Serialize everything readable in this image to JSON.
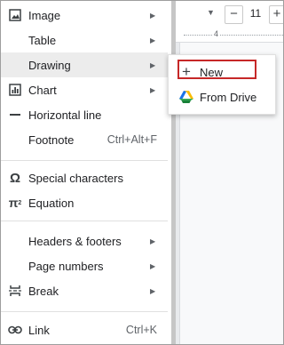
{
  "toolbar": {
    "font_size": "11",
    "decrease_label": "−",
    "increase_label": "+",
    "dropdown_icon": "caret-down-icon"
  },
  "ruler": {
    "marker": "4"
  },
  "menu": {
    "items": [
      {
        "label": "Image",
        "icon": "image-icon",
        "has_submenu": true
      },
      {
        "label": "Table",
        "icon": "",
        "has_submenu": true
      },
      {
        "label": "Drawing",
        "icon": "",
        "has_submenu": true,
        "active": true
      },
      {
        "label": "Chart",
        "icon": "chart-icon",
        "has_submenu": true
      },
      {
        "label": "Horizontal line",
        "icon": "horizontal-line-icon"
      },
      {
        "label": "Footnote",
        "icon": "",
        "shortcut": "Ctrl+Alt+F"
      },
      {
        "label": "Special characters",
        "icon": "omega-icon"
      },
      {
        "label": "Equation",
        "icon": "pi-icon"
      },
      {
        "label": "Headers & footers",
        "icon": "",
        "has_submenu": true
      },
      {
        "label": "Page numbers",
        "icon": "",
        "has_submenu": true
      },
      {
        "label": "Break",
        "icon": "page-break-icon",
        "has_submenu": true
      },
      {
        "label": "Link",
        "icon": "link-icon",
        "shortcut": "Ctrl+K"
      }
    ]
  },
  "submenu": {
    "items": [
      {
        "label": "New",
        "icon": "plus-icon",
        "highlighted": true
      },
      {
        "label": "From Drive",
        "icon": "google-drive-icon"
      }
    ]
  },
  "colors": {
    "hover_bg": "#ececec",
    "highlight_border": "#c62828",
    "text": "#202124",
    "muted": "#5f6368"
  }
}
